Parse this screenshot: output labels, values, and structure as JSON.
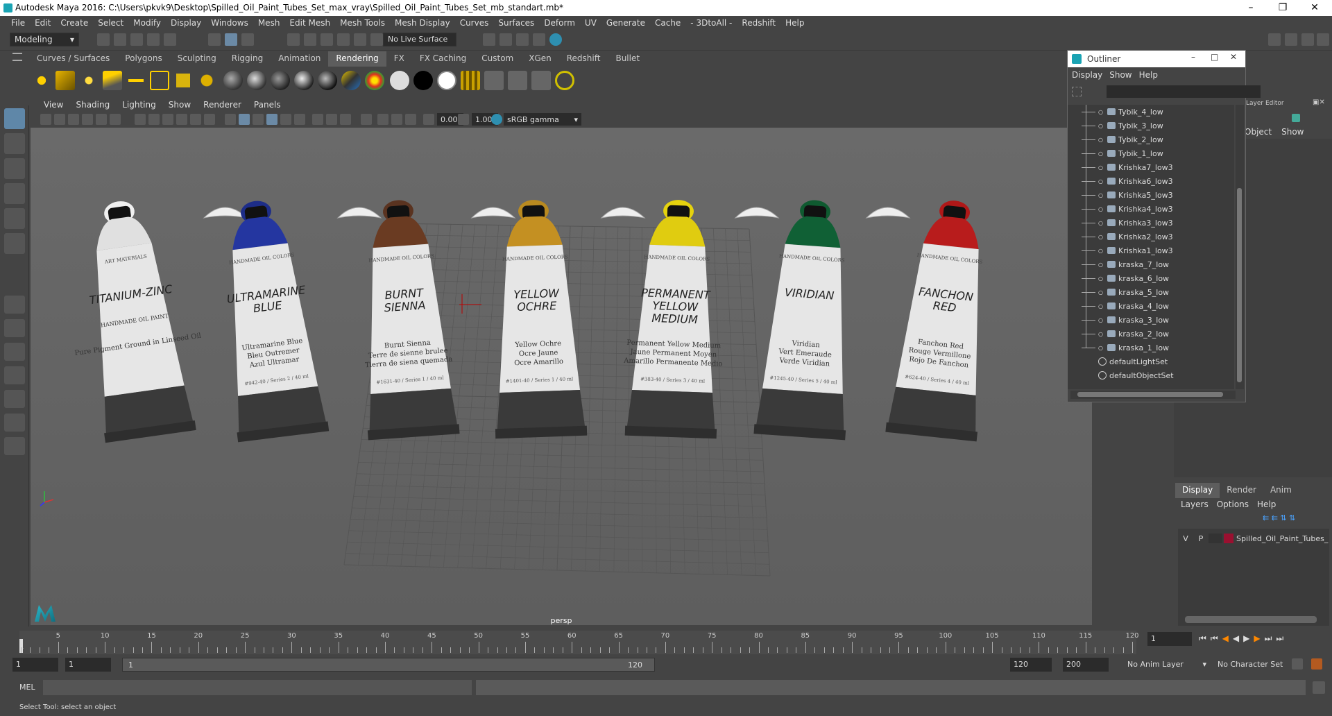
{
  "app": {
    "title": "Autodesk Maya 2016: C:\\Users\\pkvk9\\Desktop\\Spilled_Oil_Paint_Tubes_Set_max_vray\\Spilled_Oil_Paint_Tubes_Set_mb_standart.mb*"
  },
  "menu": [
    "File",
    "Edit",
    "Create",
    "Select",
    "Modify",
    "Display",
    "Windows",
    "Mesh",
    "Edit Mesh",
    "Mesh Tools",
    "Mesh Display",
    "Curves",
    "Surfaces",
    "Deform",
    "UV",
    "Generate",
    "Cache",
    "- 3DtoAll -",
    "Redshift",
    "Help"
  ],
  "status": {
    "mode": "Modeling",
    "live_surface": "No Live Surface"
  },
  "shelf_tabs": [
    "Curves / Surfaces",
    "Polygons",
    "Sculpting",
    "Rigging",
    "Animation",
    "Rendering",
    "FX",
    "FX Caching",
    "Custom",
    "XGen",
    "Redshift",
    "Bullet"
  ],
  "shelf_active": "Rendering",
  "viewport": {
    "menu": [
      "View",
      "Shading",
      "Lighting",
      "Show",
      "Renderer",
      "Panels"
    ],
    "exposure": "0.00",
    "gamma": "1.00",
    "color_space": "sRGB gamma",
    "camera": "persp"
  },
  "tubes": [
    {
      "name": "TITANIUM-ZINC",
      "sub": "Pure Pigment Ground in Linseed Oil",
      "cap": "#f0f0f0",
      "band": "#e0e0e0",
      "top": "ART MATERIALS",
      "desc": "HANDMADE OIL PAINT",
      "code": ""
    },
    {
      "name": "ULTRAMARINE BLUE",
      "sub": "Ultramarine Blue\nBleu Outremer\nAzul Ultramar",
      "cap": "#1d2d88",
      "band": "#2436a0",
      "top": "HANDMADE OIL COLORS",
      "code": "#942-40 / Series 2 / 40 ml"
    },
    {
      "name": "BURNT SIENNA",
      "sub": "Burnt Sienna\nTerre de sienne brulee\nTierra de siena quemada",
      "cap": "#5a3320",
      "band": "#6a3b22",
      "top": "HANDMADE OIL COLORS",
      "code": "#1631-40 / Series 1 / 40 ml"
    },
    {
      "name": "YELLOW OCHRE",
      "sub": "Yellow Ochre\nOcre Jaune\nOcre Amarillo",
      "cap": "#b98a20",
      "band": "#c49022",
      "top": "HANDMADE OIL COLORS",
      "code": "#1401-40 / Series 1 / 40 ml"
    },
    {
      "name": "PERMANENT YELLOW MEDIUM",
      "sub": "Permanent Yellow Medium\nJaune Permanent Moyen\nAmarillo Permanente Medio",
      "cap": "#e5d20e",
      "band": "#e0cc10",
      "top": "HANDMADE OIL COLORS",
      "code": "#383-40 / Series 3 / 40 ml"
    },
    {
      "name": "VIRIDIAN",
      "sub": "Viridian\nVert Emeraude\nVerde Viridian",
      "cap": "#0f5a30",
      "band": "#106035",
      "top": "HANDMADE OIL COLORS",
      "code": "#1245-40 / Series 5 / 40 ml"
    },
    {
      "name": "FANCHON RED",
      "sub": "Fanchon Red\nRouge Vermillone\nRojo De Fanchon",
      "cap": "#b01818",
      "band": "#b81c1c",
      "top": "HANDMADE OIL COLORS",
      "code": "#624-40 / Series 4 / 40 ml"
    }
  ],
  "outliner": {
    "title": "Outliner",
    "menu": [
      "Display",
      "Show",
      "Help"
    ],
    "items": [
      "Tybik_4_low",
      "Tybik_3_low",
      "Tybik_2_low",
      "Tybik_1_low",
      "Krishka7_low3",
      "Krishka6_low3",
      "Krishka5_low3",
      "Krishka4_low3",
      "Krishka3_low3",
      "Krishka2_low3",
      "Krishka1_low3",
      "kraska_7_low",
      "kraska_6_low",
      "kraska_5_low",
      "kraska_4_low",
      "kraska_3_low",
      "kraska_2_low",
      "kraska_1_low"
    ],
    "sets": [
      "defaultLightSet",
      "defaultObjectSet"
    ]
  },
  "layer_editor": {
    "title": "Layer Editor",
    "menu": [
      "Object",
      "Show"
    ],
    "tabs": [
      "Display",
      "Render",
      "Anim"
    ],
    "active_tab": "Display",
    "submenu": [
      "Layers",
      "Options",
      "Help"
    ],
    "layer": {
      "v": "V",
      "p": "P",
      "name": "Spilled_Oil_Paint_Tubes_",
      "color": "#9a1030"
    }
  },
  "timeline": {
    "ticks": [
      "5",
      "10",
      "15",
      "20",
      "25",
      "30",
      "35",
      "40",
      "45",
      "50",
      "55",
      "60",
      "65",
      "70",
      "75",
      "80",
      "85",
      "90",
      "95",
      "100",
      "105",
      "110",
      "115",
      "120"
    ],
    "first_tick": "1",
    "current": "1"
  },
  "range": {
    "start": "1",
    "start2": "1",
    "slider_start": "1",
    "slider_end": "120",
    "end": "120",
    "end2": "200",
    "anim_layer": "No Anim Layer",
    "char_set": "No Character Set"
  },
  "cmd": {
    "label": "MEL"
  },
  "help": {
    "text": "Select Tool: select an object"
  }
}
